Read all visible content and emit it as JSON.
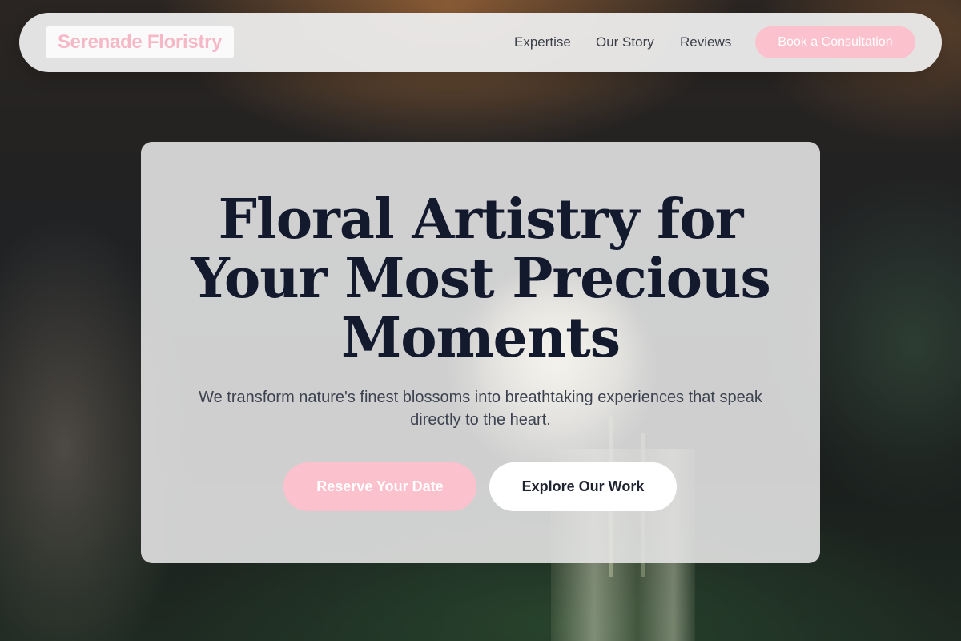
{
  "brand": {
    "name": "Serenade Floristry",
    "accent": "#fbc1cc",
    "text_dark": "#141a2e"
  },
  "nav": {
    "links": [
      {
        "label": "Expertise"
      },
      {
        "label": "Our Story"
      },
      {
        "label": "Reviews"
      }
    ],
    "cta_label": "Book a Consultation"
  },
  "hero": {
    "title_line1": "Floral Artistry for",
    "title_line2": "Your Most Precious",
    "title_line3": "Moments",
    "subtitle": "We transform nature's finest blossoms into breathtaking experiences that speak directly to the heart.",
    "primary_button": "Reserve Your Date",
    "secondary_button": "Explore Our Work"
  }
}
